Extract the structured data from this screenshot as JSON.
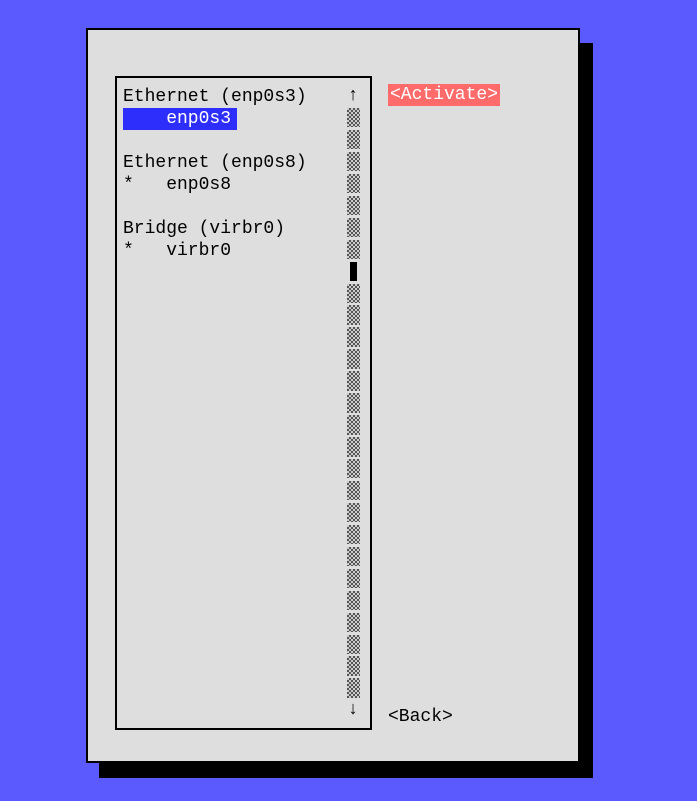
{
  "list": {
    "groups": [
      {
        "header": "Ethernet (enp0s3)",
        "entry": {
          "marker": " ",
          "name": "enp0s3",
          "selected": true
        }
      },
      {
        "header": "Ethernet (enp0s8)",
        "entry": {
          "marker": "*",
          "name": "enp0s8",
          "selected": false
        }
      },
      {
        "header": "Bridge (virbr0)",
        "entry": {
          "marker": "*",
          "name": "virbr0",
          "selected": false
        }
      }
    ],
    "arrow_up": "↑",
    "arrow_down": "↓",
    "scrollbar_cells": 27,
    "thumb_index": 7
  },
  "buttons": {
    "activate": "<Activate>",
    "back": "<Back>"
  }
}
